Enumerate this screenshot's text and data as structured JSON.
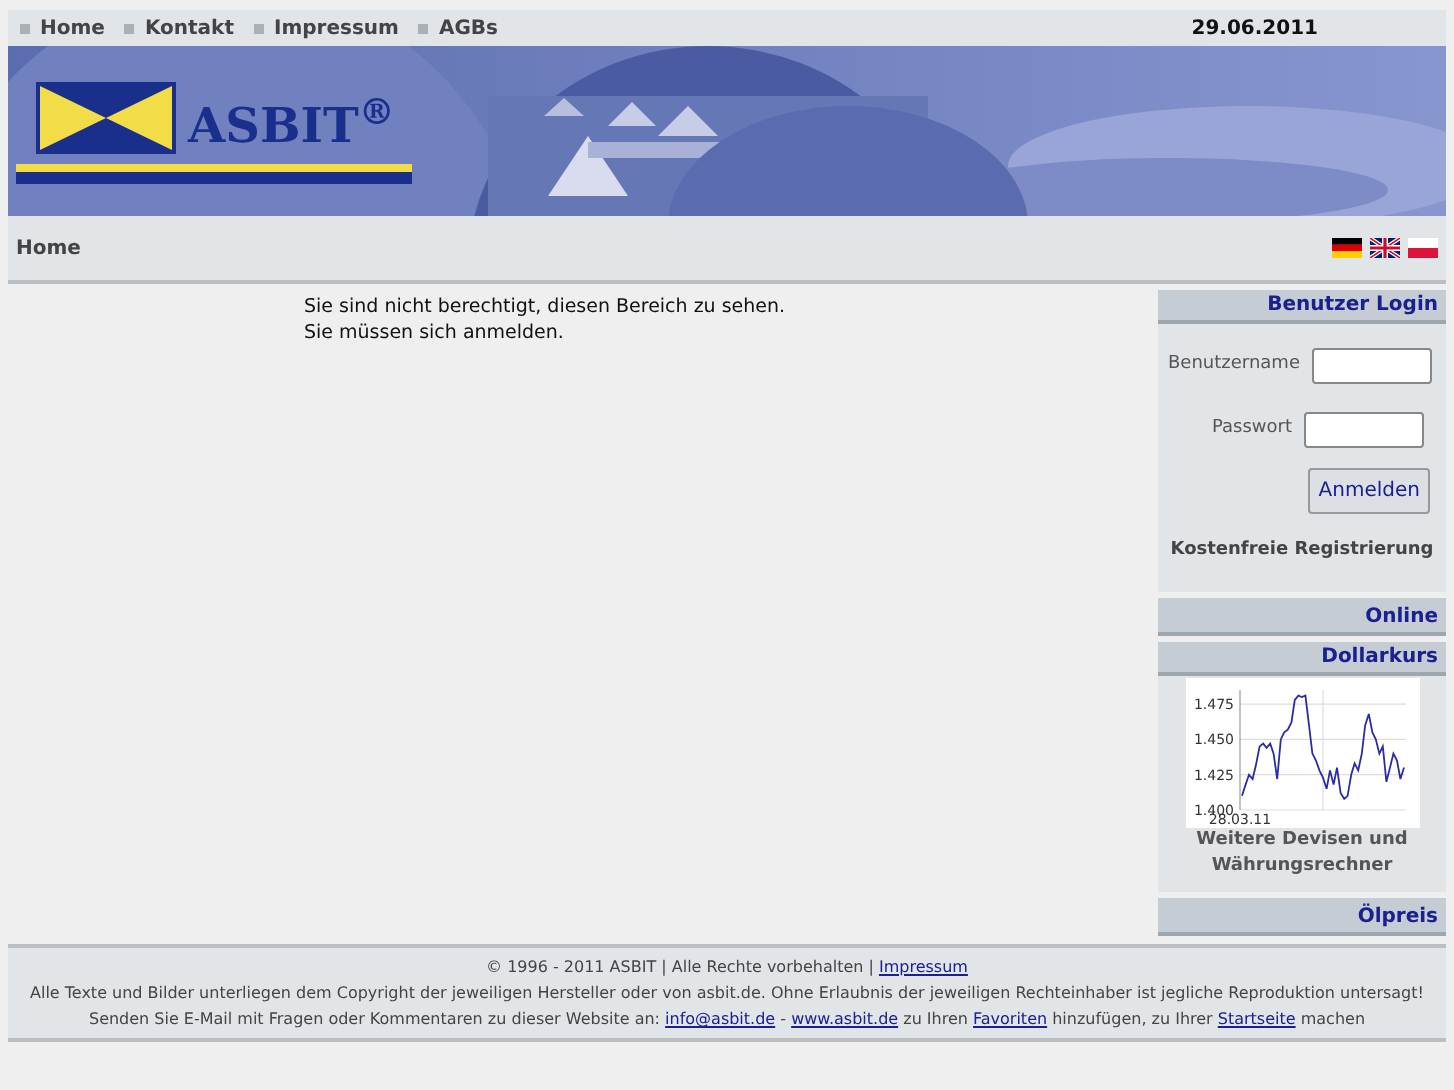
{
  "nav": [
    {
      "label": "Home"
    },
    {
      "label": "Kontakt"
    },
    {
      "label": "Impressum"
    },
    {
      "label": "AGBs"
    }
  ],
  "date": "29.06.2011",
  "logo": {
    "text": "ASBIT$^{®}$"
  },
  "breadcrumb": "Home",
  "languages": [
    {
      "kind": "de"
    },
    {
      "kind": "gb"
    },
    {
      "kind": "pl"
    }
  ],
  "message": [
    "Sie sind nicht berechtigt, diesen Bereich zu sehen.",
    "Sie müssen sich anmelden."
  ],
  "login": {
    "title": "Benutzer Login",
    "username_label": "Benutzername",
    "password_label": "Passwort",
    "button": "Anmelden",
    "register": "Kostenfreie Registrierung"
  },
  "online": {
    "title": "Online"
  },
  "dollar": {
    "title": "Dollarkurs",
    "link": "Weitere Devisen und Währungsrechner",
    "chart_data": {
      "type": "line",
      "grid": true,
      "xlabel": "28.03.11",
      "series": [
        {
          "color": "#2b2ba8",
          "values": [
            1.41,
            1.418,
            1.425,
            1.422,
            1.432,
            1.445,
            1.447,
            1.444,
            1.447,
            1.44,
            1.422,
            1.45,
            1.455,
            1.457,
            1.462,
            1.478,
            1.481,
            1.48,
            1.481,
            1.46,
            1.44,
            1.435,
            1.428,
            1.423,
            1.415,
            1.428,
            1.418,
            1.43,
            1.412,
            1.408,
            1.41,
            1.425,
            1.433,
            1.428,
            1.44,
            1.46,
            1.468,
            1.455,
            1.45,
            1.44,
            1.445,
            1.42,
            1.43,
            1.44,
            1.435,
            1.422,
            1.43
          ]
        }
      ],
      "ylim": [
        1.4,
        1.485
      ],
      "yticks": [
        {
          "value": 1.4,
          "label": "1.400"
        },
        {
          "value": 1.425,
          "label": "1.425"
        },
        {
          "value": 1.45,
          "label": "1.450"
        },
        {
          "value": 1.475,
          "label": "1.475"
        }
      ]
    }
  },
  "oil": {
    "title": "Ölpreis"
  },
  "footer": [
    [
      {
        "kind": "text",
        "text": "© 1996 - 2011 ASBIT | Alle Rechte vorbehalten | "
      },
      {
        "kind": "link",
        "text": "Impressum"
      }
    ],
    [
      {
        "kind": "text",
        "text": "Alle Texte und Bilder unterliegen dem Copyright der jeweiligen Hersteller oder von asbit.de. Ohne Erlaubnis der jeweiligen Rechteinhaber ist jegliche Reproduktion untersagt!"
      }
    ],
    [
      {
        "kind": "text",
        "text": "Senden Sie E-Mail mit Fragen oder Kommentaren zu dieser Website an: "
      },
      {
        "kind": "link",
        "text": "info@asbit.de"
      },
      {
        "kind": "text",
        "text": " - "
      },
      {
        "kind": "link",
        "text": "www.asbit.de"
      },
      {
        "kind": "text",
        "text": " zu Ihren "
      },
      {
        "kind": "link",
        "text": "Favoriten"
      },
      {
        "kind": "text",
        "text": " hinzufügen, zu Ihrer "
      },
      {
        "kind": "link",
        "text": "Startseite"
      },
      {
        "kind": "text",
        "text": " machen"
      }
    ]
  ]
}
